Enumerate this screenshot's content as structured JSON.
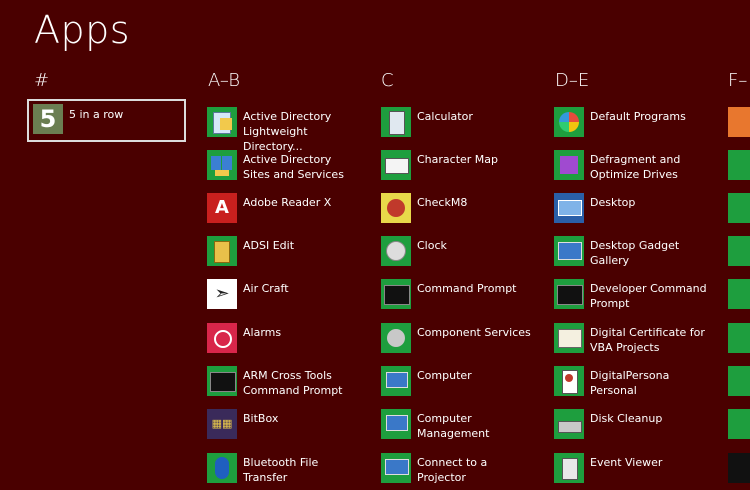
{
  "title": "Apps",
  "groups": [
    {
      "header": "#"
    },
    {
      "header": "A–B"
    },
    {
      "header": "C"
    },
    {
      "header": "D–E"
    },
    {
      "header": "F–"
    }
  ],
  "hash": [
    {
      "label": "5 in a row",
      "icon": "five-in-a-row-icon"
    }
  ],
  "ab": [
    {
      "label": "Active Directory Lightweight Directory...",
      "icon": "ad-lds-icon"
    },
    {
      "label": "Active Directory Sites and Services",
      "icon": "ad-sites-icon"
    },
    {
      "label": "Adobe Reader X",
      "icon": "adobe-reader-icon"
    },
    {
      "label": "ADSI Edit",
      "icon": "adsi-edit-icon"
    },
    {
      "label": "Air Craft",
      "icon": "paper-plane-icon"
    },
    {
      "label": "Alarms",
      "icon": "alarm-clock-icon"
    },
    {
      "label": "ARM Cross Tools Command Prompt",
      "icon": "command-prompt-icon"
    },
    {
      "label": "BitBox",
      "icon": "bitbox-icon"
    },
    {
      "label": "Bluetooth File Transfer",
      "icon": "bluetooth-icon"
    }
  ],
  "c": [
    {
      "label": "Calculator",
      "icon": "calculator-icon"
    },
    {
      "label": "Character Map",
      "icon": "character-map-icon"
    },
    {
      "label": "CheckM8",
      "icon": "checkm8-icon"
    },
    {
      "label": "Clock",
      "icon": "clock-icon"
    },
    {
      "label": "Command Prompt",
      "icon": "command-prompt-icon"
    },
    {
      "label": "Component Services",
      "icon": "component-services-icon"
    },
    {
      "label": "Computer",
      "icon": "computer-icon"
    },
    {
      "label": "Computer Management",
      "icon": "computer-management-icon"
    },
    {
      "label": "Connect to a Projector",
      "icon": "projector-icon"
    }
  ],
  "de": [
    {
      "label": "Default Programs",
      "icon": "default-programs-icon"
    },
    {
      "label": "Defragment and Optimize Drives",
      "icon": "defragment-icon"
    },
    {
      "label": "Desktop",
      "icon": "desktop-icon"
    },
    {
      "label": "Desktop Gadget Gallery",
      "icon": "gadget-gallery-icon"
    },
    {
      "label": "Developer Command Prompt",
      "icon": "command-prompt-icon"
    },
    {
      "label": "Digital Certificate for VBA Projects",
      "icon": "certificate-icon"
    },
    {
      "label": "DigitalPersona Personal",
      "icon": "digitalpersona-icon"
    },
    {
      "label": "Disk Cleanup",
      "icon": "disk-cleanup-icon"
    },
    {
      "label": "Event Viewer",
      "icon": "event-viewer-icon"
    }
  ],
  "f": [
    {
      "icon": "folder-icon"
    },
    {
      "icon": "sync-icon"
    },
    {
      "icon": "sync-icon"
    },
    {
      "icon": "window-icon"
    },
    {
      "icon": "window-icon"
    },
    {
      "icon": "window-icon"
    },
    {
      "icon": "window-icon"
    },
    {
      "icon": "help-icon"
    },
    {
      "icon": "tool-icon"
    },
    {
      "icon": "media-icon"
    }
  ]
}
